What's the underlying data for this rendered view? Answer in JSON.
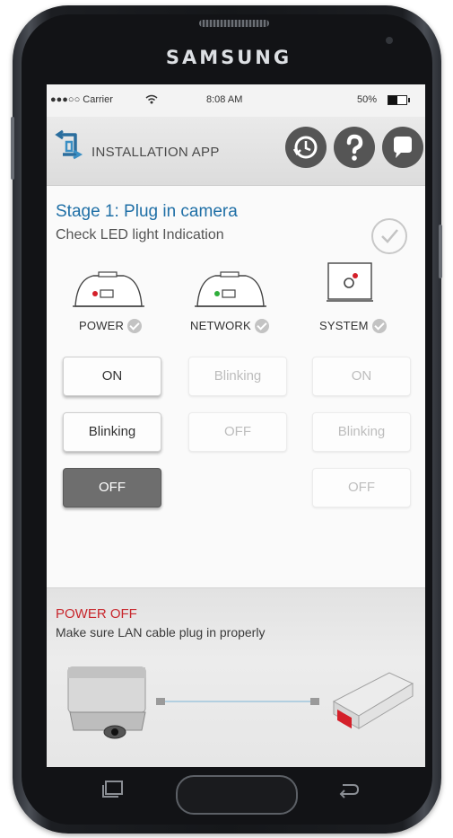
{
  "device": {
    "brand": "SAMSUNG"
  },
  "status_bar": {
    "carrier": "●●●○○ Carrier",
    "time": "8:08 AM",
    "battery": "50%",
    "battery_level": 0.5
  },
  "header": {
    "title": "INSTALLATION APP",
    "icons": [
      "history-icon",
      "help-icon",
      "chat-icon"
    ]
  },
  "stage": {
    "title": "Stage 1: Plug in camera",
    "subtitle": "Check LED light Indication",
    "complete_icon": "check-circle-icon"
  },
  "indicators": [
    {
      "label": "POWER",
      "states": [
        "ON",
        "Blinking",
        "OFF"
      ],
      "selected": "OFF"
    },
    {
      "label": "NETWORK",
      "states": [
        "Blinking",
        "OFF"
      ],
      "selected": ""
    },
    {
      "label": "SYSTEM",
      "states": [
        "ON",
        "Blinking",
        "OFF"
      ],
      "selected": ""
    }
  ],
  "info": {
    "title": "POWER OFF",
    "text": "Make sure LAN cable plug in properly"
  },
  "colors": {
    "accent_blue": "#1f6fa6",
    "alert_red": "#c8262c",
    "header_icon": "#555555",
    "selected_button": "#6e6e6e"
  }
}
